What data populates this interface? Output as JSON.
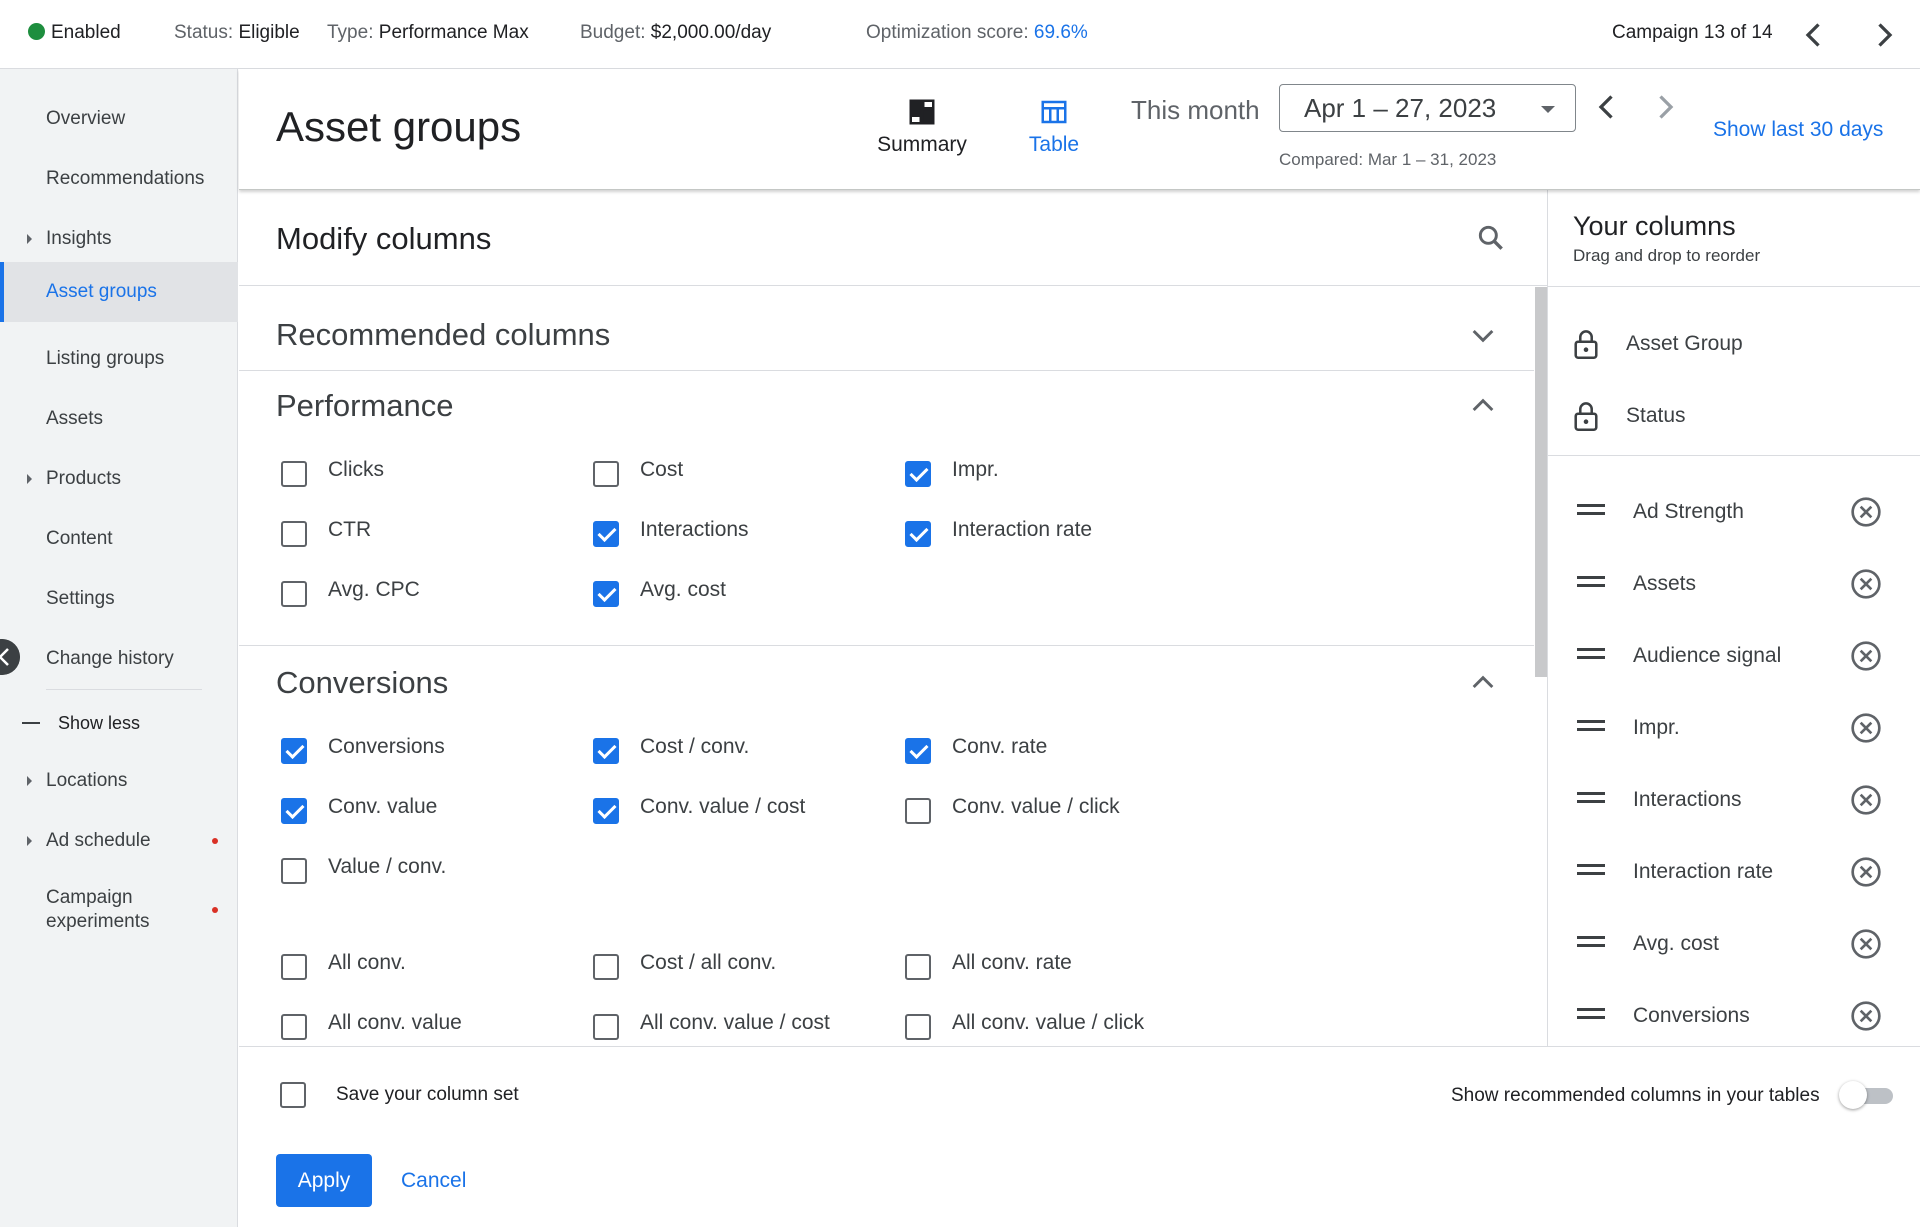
{
  "topbar": {
    "enabled": "Enabled",
    "status_label": "Status:",
    "status_value": "Eligible",
    "type_label": "Type:",
    "type_value": "Performance Max",
    "budget_label": "Budget:",
    "budget_value": "$2,000.00/day",
    "opt_label": "Optimization score:",
    "opt_value": "69.6%",
    "campaign_counter": "Campaign 13 of 14",
    "status_color": "#1e8e3e"
  },
  "sidebar": {
    "items": [
      {
        "label": "Overview"
      },
      {
        "label": "Recommendations"
      },
      {
        "label": "Insights"
      },
      {
        "label": "Asset groups"
      },
      {
        "label": "Listing groups"
      },
      {
        "label": "Assets"
      },
      {
        "label": "Products"
      },
      {
        "label": "Content"
      },
      {
        "label": "Settings"
      },
      {
        "label": "Change history"
      },
      {
        "label": "Show less"
      },
      {
        "label": "Locations"
      },
      {
        "label": "Ad schedule"
      },
      {
        "label": "Campaign experiments"
      }
    ]
  },
  "header": {
    "title": "Asset groups",
    "tab_summary": "Summary",
    "tab_table": "Table",
    "this_month": "This month",
    "date_range": "Apr 1 – 27, 2023",
    "compared": "Compared: Mar 1 – 31, 2023",
    "show_last": "Show last 30 days"
  },
  "modify": {
    "title": "Modify columns",
    "recommended": "Recommended columns",
    "performance": {
      "title": "Performance",
      "items": [
        {
          "label": "Clicks",
          "checked": false
        },
        {
          "label": "Cost",
          "checked": false
        },
        {
          "label": "Impr.",
          "checked": true
        },
        {
          "label": "CTR",
          "checked": false
        },
        {
          "label": "Interactions",
          "checked": true
        },
        {
          "label": "Interaction rate",
          "checked": true
        },
        {
          "label": "Avg. CPC",
          "checked": false
        },
        {
          "label": "Avg. cost",
          "checked": true
        }
      ]
    },
    "conversions": {
      "title": "Conversions",
      "items": [
        {
          "label": "Conversions",
          "checked": true
        },
        {
          "label": "Cost / conv.",
          "checked": true
        },
        {
          "label": "Conv. rate",
          "checked": true
        },
        {
          "label": "Conv. value",
          "checked": true
        },
        {
          "label": "Conv. value / cost",
          "checked": true
        },
        {
          "label": "Conv. value / click",
          "checked": false
        },
        {
          "label": "Value / conv.",
          "checked": false
        },
        {
          "label": "All conv.",
          "checked": false
        },
        {
          "label": "Cost / all conv.",
          "checked": false
        },
        {
          "label": "All conv. rate",
          "checked": false
        },
        {
          "label": "All conv. value",
          "checked": false
        },
        {
          "label": "All conv. value / cost",
          "checked": false
        },
        {
          "label": "All conv. value / click",
          "checked": false
        }
      ]
    }
  },
  "your_columns": {
    "title": "Your columns",
    "subtitle": "Drag and drop to reorder",
    "locked": [
      "Asset Group",
      "Status"
    ],
    "items": [
      "Ad Strength",
      "Assets",
      "Audience signal",
      "Impr.",
      "Interactions",
      "Interaction rate",
      "Avg. cost",
      "Conversions"
    ]
  },
  "footer": {
    "save_set": "Save your column set",
    "show_recommended": "Show recommended columns in your tables",
    "apply": "Apply",
    "cancel": "Cancel"
  }
}
